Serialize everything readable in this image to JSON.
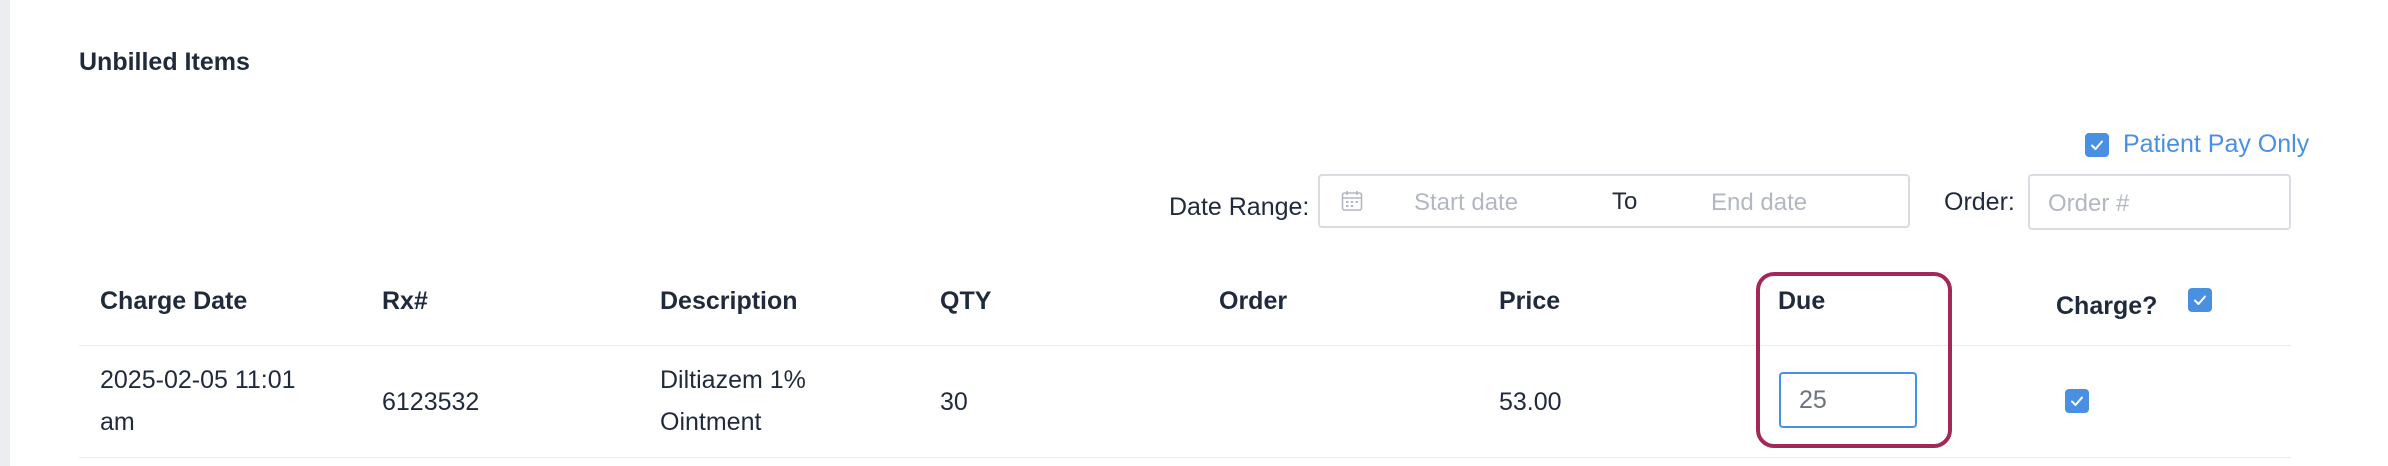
{
  "section": {
    "title": "Unbilled Items"
  },
  "filters": {
    "patient_pay_only": {
      "label": "Patient Pay Only",
      "checked": true
    },
    "date_range_label": "Date Range:",
    "start_placeholder": "Start date",
    "to_label": "To",
    "end_placeholder": "End date",
    "order_label": "Order:",
    "order_placeholder": "Order #"
  },
  "table": {
    "headers": {
      "charge_date": "Charge Date",
      "rx": "Rx#",
      "description": "Description",
      "qty": "QTY",
      "order": "Order",
      "price": "Price",
      "due": "Due",
      "charge": "Charge?"
    },
    "header_charge_checked": true,
    "rows": [
      {
        "charge_date_line1": "2025-02-05 11:01",
        "charge_date_line2": "am",
        "rx": "6123532",
        "description_line1": "Diltiazem 1%",
        "description_line2": "Ointment",
        "qty": "30",
        "order": "",
        "price": "53.00",
        "due": "25",
        "charge_checked": true
      }
    ]
  },
  "colors": {
    "accent": "#4a90e2",
    "highlight": "#a3285a",
    "text": "#1f2a3c",
    "placeholder": "#b2b8c2"
  },
  "icons": {
    "calendar": "calendar-icon",
    "check": "checkmark-icon"
  }
}
